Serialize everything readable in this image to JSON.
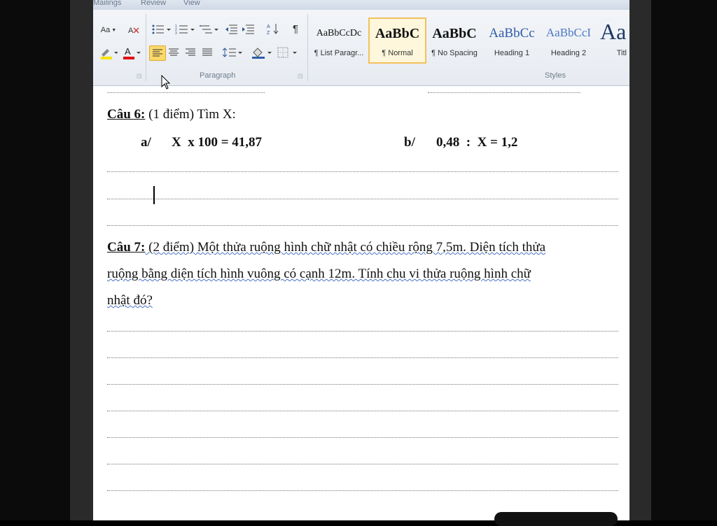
{
  "ribbon": {
    "tabs": [
      "Mailings",
      "Review",
      "View"
    ],
    "font_size_label": "Aa",
    "paragraph_label": "Paragraph",
    "styles_label": "Styles",
    "styles": [
      {
        "sample": "AaBbCcDc",
        "name": "¶ List Paragr..."
      },
      {
        "sample": "AaBbC",
        "name": "¶ Normal"
      },
      {
        "sample": "AaBbC",
        "name": "¶ No Spacing"
      },
      {
        "sample": "AaBbCc",
        "name": "Heading 1"
      },
      {
        "sample": "AaBbCcI",
        "name": "Heading 2"
      },
      {
        "sample": "Aa",
        "name": "Titl"
      }
    ],
    "colors": {
      "highlight": "#f5e400",
      "font_color": "#e01010",
      "accent": "#fbd96a"
    }
  },
  "document": {
    "q6": {
      "label": "Câu 6:",
      "points": " (1 điểm) Tìm X:",
      "a_label": "a/",
      "a_expr": "X  x 100 = 41,87",
      "b_label": "b/",
      "b_expr": "0,48  :  X = 1,2"
    },
    "q7": {
      "label": "Câu 7:",
      "line1": " (2 điểm) Một thửa ruộng hình chữ nhật có chiều rộng 7,5m. Diện tích thửa",
      "line2": "ruộng bằng diện tích hình vuông có cạnh 12m. Tính chu vi thửa ruộng hình chữ",
      "line3": "nhật đó?"
    }
  }
}
